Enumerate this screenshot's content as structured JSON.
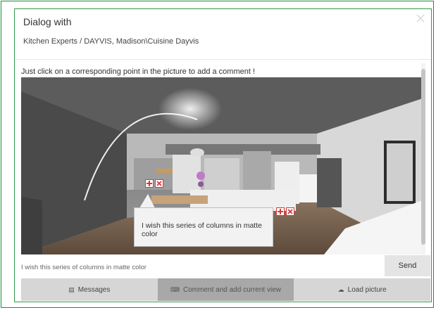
{
  "dialog": {
    "title": "Dialog with",
    "subtitle": "Kitchen Experts / DAYVIS, Madison\\Cuisine Dayvis",
    "close_icon": "close-icon"
  },
  "instruction": "Just click on a corresponding point in the picture to add a comment !",
  "picture": {
    "description_icon": "kitchen-render-image",
    "comment_bubble": "I wish this series of columns in matte color"
  },
  "markers": [
    {
      "add_icon": "add-cross-icon",
      "remove_icon": "remove-x-icon"
    },
    {
      "add_icon": "add-cross-icon",
      "remove_icon": "remove-x-icon"
    }
  ],
  "comment": {
    "value": "I wish this series of columns in matte color",
    "placeholder": ""
  },
  "buttons": {
    "send": "Send"
  },
  "tabs": [
    {
      "label": "Messages",
      "icon": "message-icon"
    },
    {
      "label": "Comment and add current view",
      "icon": "keyboard-icon",
      "active": true
    },
    {
      "label": "Load picture",
      "icon": "cloud-upload-icon"
    }
  ],
  "colors": {
    "frame_border": "#1e8a3c",
    "marker_red": "#d43a3a",
    "active_tab": "#a8a8a8",
    "tab": "#d6d6d6"
  }
}
